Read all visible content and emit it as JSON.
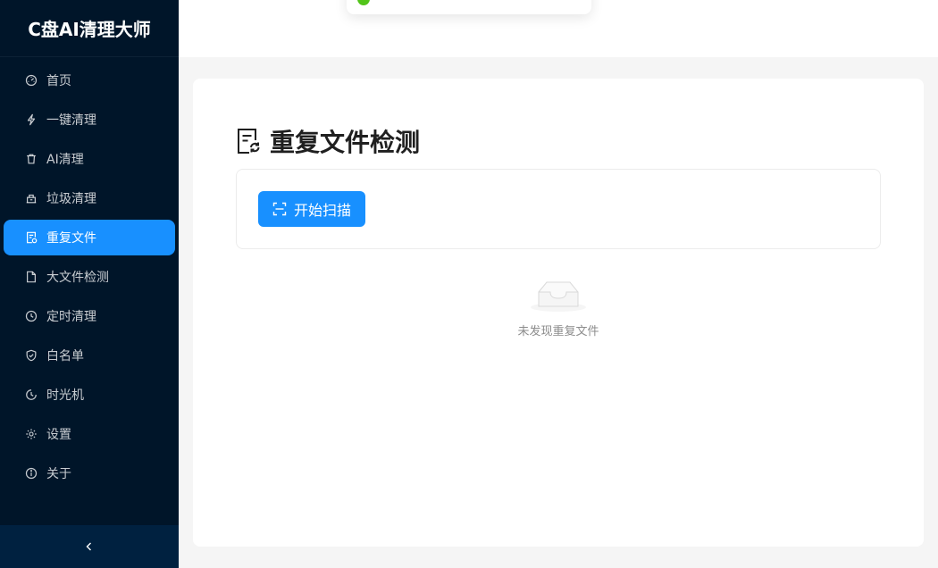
{
  "app": {
    "title": "C盘AI清理大师"
  },
  "sidebar": {
    "items": [
      {
        "label": "首页",
        "icon": "dashboard-icon",
        "active": false
      },
      {
        "label": "一键清理",
        "icon": "thunderbolt-icon",
        "active": false
      },
      {
        "label": "AI清理",
        "icon": "trash-icon",
        "active": false
      },
      {
        "label": "垃圾清理",
        "icon": "bin-icon",
        "active": false
      },
      {
        "label": "重复文件",
        "icon": "file-sync-icon",
        "active": true
      },
      {
        "label": "大文件检测",
        "icon": "file-icon",
        "active": false
      },
      {
        "label": "定时清理",
        "icon": "clock-icon",
        "active": false
      },
      {
        "label": "白名单",
        "icon": "shield-check-icon",
        "active": false
      },
      {
        "label": "时光机",
        "icon": "history-icon",
        "active": false
      },
      {
        "label": "设置",
        "icon": "gear-icon",
        "active": false
      },
      {
        "label": "关于",
        "icon": "info-icon",
        "active": false
      }
    ],
    "collapse_icon": "chevron-left-icon"
  },
  "header": {
    "toast_icon": "check-circle-icon",
    "toast_text": ""
  },
  "main": {
    "title": "重复文件检测",
    "title_icon": "file-sync-icon",
    "scan_button": {
      "label": "开始扫描",
      "icon": "scan-icon"
    },
    "empty": {
      "text": "未发现重复文件",
      "icon": "empty-inbox-icon"
    }
  },
  "colors": {
    "sidebar_bg": "#001529",
    "accent": "#1890ff",
    "content_bg": "#f5f5f5"
  }
}
